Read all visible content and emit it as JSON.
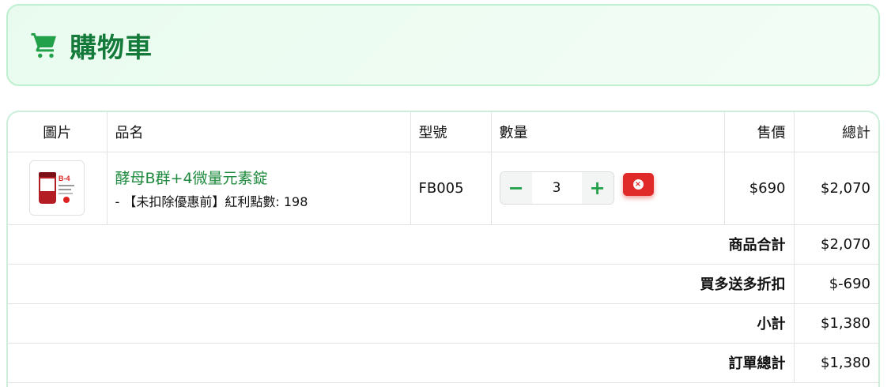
{
  "header": {
    "title": "購物車",
    "icon": "shopping-cart-icon",
    "accent": "#137a3a"
  },
  "table": {
    "columns": [
      "圖片",
      "品名",
      "型號",
      "數量",
      "售價",
      "總計"
    ],
    "items": [
      {
        "name": "酵母B群+4微量元素錠",
        "note": "- 【未扣除優惠前】紅利點數: 198",
        "model": "FB005",
        "quantity": "3",
        "price": "$690",
        "total": "$2,070",
        "thumb_label": "B-4"
      }
    ],
    "summary": [
      {
        "label": "商品合計",
        "value": "$2,070"
      },
      {
        "label": "買多送多折扣",
        "value": "$-690"
      },
      {
        "label": "小計",
        "value": "$1,380"
      },
      {
        "label": "訂單總計",
        "value": "$1,380"
      }
    ]
  },
  "controls": {
    "minus": "−",
    "plus": "+",
    "remove_icon": "×"
  }
}
